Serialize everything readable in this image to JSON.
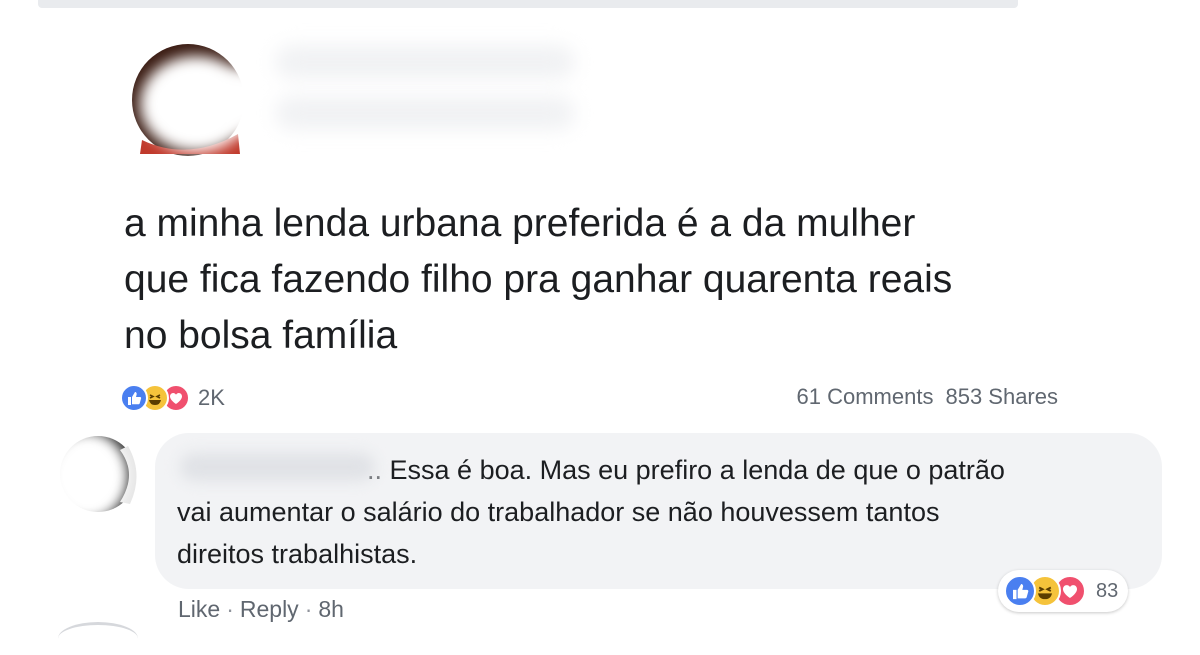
{
  "post": {
    "text_lines": [
      "a minha lenda urbana preferida é a da mulher",
      "que fica fazendo filho pra ganhar quarenta reais",
      "no bolsa família"
    ],
    "reaction_count": "2K",
    "comments": "61 Comments",
    "shares": "853 Shares",
    "reaction_icons": [
      "like-icon",
      "haha-icon",
      "love-icon"
    ]
  },
  "comment": {
    "author_tail": "..",
    "text_lines": [
      "Essa é boa. Mas eu prefiro a lenda de que o patrão",
      "vai aumentar o salário do trabalhador se não houvessem tantos",
      "direitos trabalhistas."
    ],
    "reaction_count": "83",
    "actions": {
      "like": "Like",
      "reply": "Reply",
      "time": "8h",
      "separator": "·"
    }
  },
  "colors": {
    "like": "#4a7ff0",
    "haha": "#f5c33b",
    "love": "#f0506e",
    "bubble": "#f2f3f5",
    "meta_text": "#606770"
  }
}
